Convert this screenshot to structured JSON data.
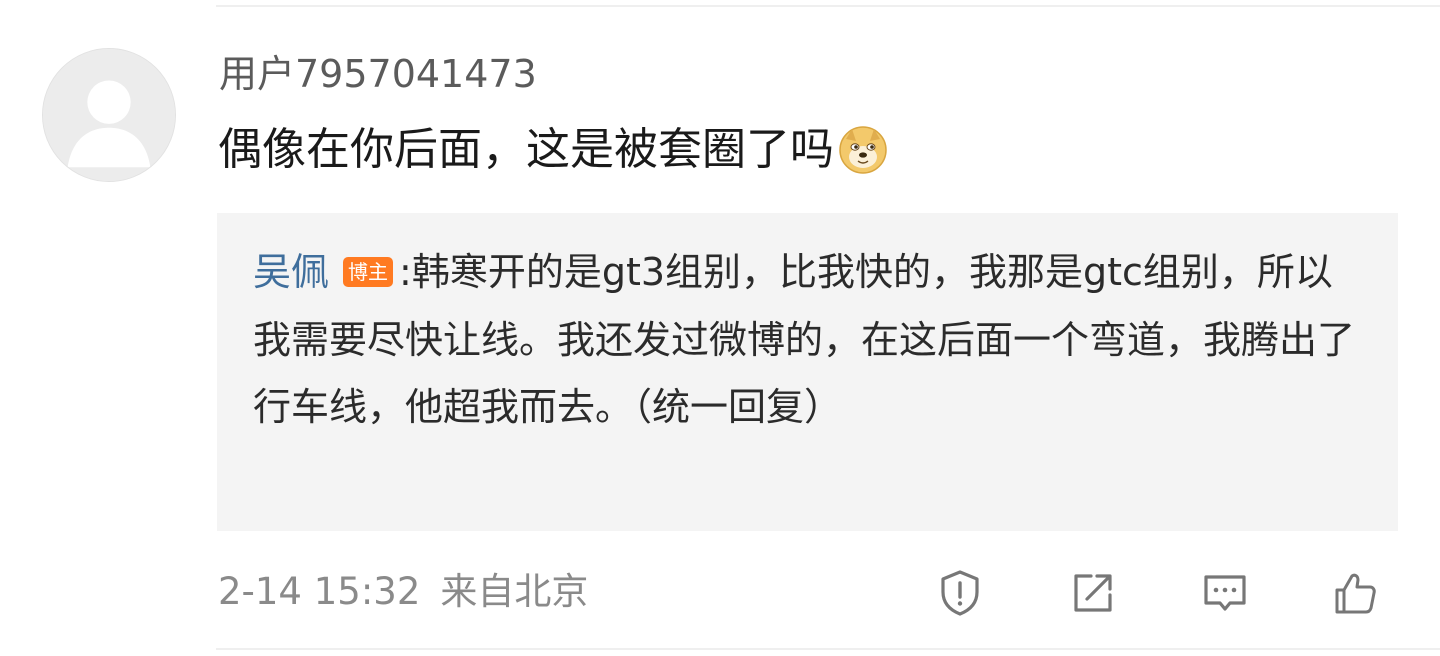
{
  "comment": {
    "username": "用户7957041473",
    "text": "偶像在你后面，这是被套圈了吗",
    "emoji": "doge-icon"
  },
  "reply": {
    "author": "吴佩",
    "badge": "博主",
    "text": ":韩寒开的是gt3组别，比我快的，我那是gtc组别，所以我需要尽快让线。我还发过微博的，在这后面一个弯道，我腾出了行车线，他超我而去。（统一回复）"
  },
  "meta": {
    "timestamp": "2-14 15:32",
    "location": "来自北京"
  },
  "actions": [
    {
      "name": "report",
      "icon": "exclamation-shield-icon"
    },
    {
      "name": "share",
      "icon": "share-icon"
    },
    {
      "name": "comment",
      "icon": "comment-icon"
    },
    {
      "name": "like",
      "icon": "thumbs-up-icon"
    }
  ],
  "colors": {
    "reply_author": "#3f6e9c",
    "badge_bg": "#ff7a21",
    "reply_bg": "#f4f4f4",
    "meta_text": "#8a8a8a"
  }
}
